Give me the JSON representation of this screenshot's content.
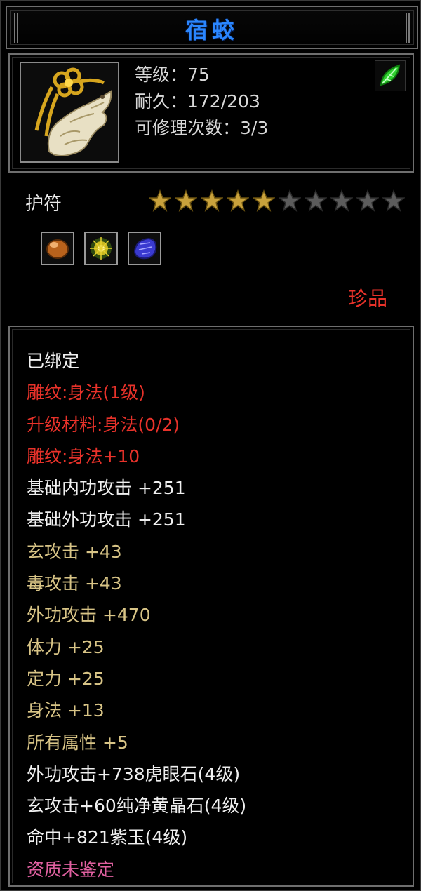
{
  "title": "宿蛟",
  "item": {
    "level_label": "等级：75",
    "durability_label": "耐久：172/203",
    "repairs_label": "可修理次数：3/3",
    "icon_name": "jade-dragon-amulet-icon",
    "badge_icon": "green-leaf-icon"
  },
  "type_label": "护符",
  "stars": {
    "filled": 5,
    "total": 10,
    "filled_color": "#c9a23c",
    "empty_color": "#5c5c5c"
  },
  "gems": [
    {
      "icon": "amber-stone-icon",
      "color": "#b8621c"
    },
    {
      "icon": "yellow-crystal-icon",
      "color": "#c9b820"
    },
    {
      "icon": "purple-jade-icon",
      "color": "#3a3ad0"
    }
  ],
  "rarity": "珍品",
  "colors": {
    "title": "#2a86ff",
    "red": "#e8322a",
    "white": "#f0f0f0",
    "gold": "#d8c486",
    "pink": "#e060a0"
  },
  "properties": [
    {
      "text": "已绑定",
      "color": "#f0f0f0"
    },
    {
      "text": "雕纹:身法(1级)",
      "color": "#e8322a"
    },
    {
      "text": "升级材料:身法(0/2)",
      "color": "#e8322a"
    },
    {
      "text": "雕纹:身法+10",
      "color": "#e8322a"
    },
    {
      "text": "基础内功攻击 +251",
      "color": "#f0f0f0"
    },
    {
      "text": "基础外功攻击 +251",
      "color": "#f0f0f0"
    },
    {
      "text": "玄攻击 +43",
      "color": "#d8c486"
    },
    {
      "text": "毒攻击 +43",
      "color": "#d8c486"
    },
    {
      "text": "外功攻击 +470",
      "color": "#d8c486"
    },
    {
      "text": "体力 +25",
      "color": "#d8c486"
    },
    {
      "text": "定力 +25",
      "color": "#d8c486"
    },
    {
      "text": "身法 +13",
      "color": "#d8c486"
    },
    {
      "text": "所有属性 +5",
      "color": "#d8c486"
    },
    {
      "text": "外功攻击+738虎眼石(4级)",
      "color": "#f0f0f0"
    },
    {
      "text": "玄攻击+60纯净黄晶石(4级)",
      "color": "#f0f0f0"
    },
    {
      "text": "命中+821紫玉(4级)",
      "color": "#f0f0f0"
    },
    {
      "text": "资质未鉴定",
      "color": "#e060a0"
    }
  ]
}
